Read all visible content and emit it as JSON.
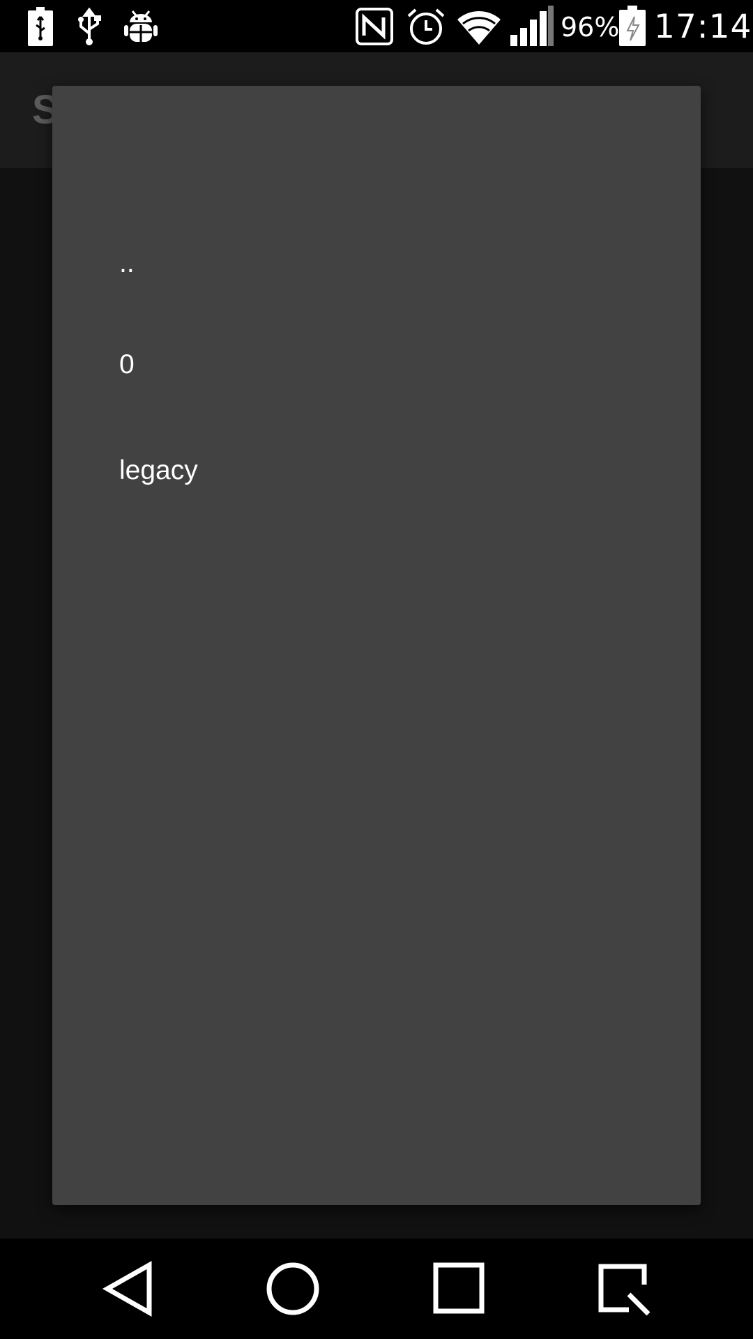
{
  "status_bar": {
    "battery_percent": "96%",
    "time": "17:14",
    "left_icons": [
      "battery-usb-icon",
      "usb-icon",
      "android-debug-icon"
    ],
    "right_icons": [
      "nfc-icon",
      "alarm-icon",
      "wifi-icon",
      "signal-icon",
      "battery-charging-icon"
    ]
  },
  "app_bar": {
    "title_partial": "S"
  },
  "dialog": {
    "items": [
      {
        "label": ".."
      },
      {
        "label": "0"
      },
      {
        "label": "legacy"
      }
    ]
  },
  "nav_bar": {
    "buttons": [
      "back-icon",
      "home-icon",
      "recents-icon",
      "screenshot-icon"
    ]
  },
  "colors": {
    "dialog_bg": "#424242",
    "scrim_bg": "#111111",
    "text": "#ffffff"
  }
}
